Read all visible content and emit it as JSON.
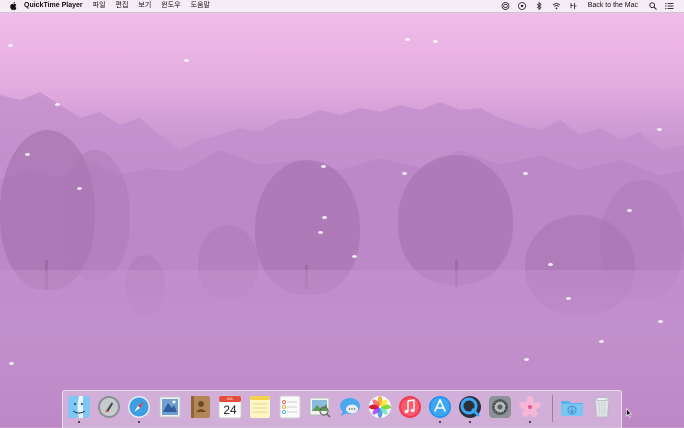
{
  "menubar": {
    "app_name": "QuickTime Player",
    "menus": [
      "파일",
      "편집",
      "보기",
      "윈도우",
      "도움말"
    ],
    "user_name": "Back to the Mac",
    "status_icons": [
      "quicktime-record-icon",
      "info-icon",
      "bluetooth-icon",
      "wifi-icon",
      "input-source-icon"
    ],
    "right_icons": [
      "spotlight-icon",
      "notification-center-icon"
    ]
  },
  "dock": {
    "items": [
      {
        "name": "finder",
        "icon": "finder-icon",
        "running": true
      },
      {
        "name": "launchpad",
        "icon": "launchpad-icon",
        "running": false
      },
      {
        "name": "safari",
        "icon": "safari-icon",
        "running": true
      },
      {
        "name": "mail",
        "icon": "mail-stamp-icon",
        "running": false
      },
      {
        "name": "contacts",
        "icon": "contacts-icon",
        "running": false
      },
      {
        "name": "calendar",
        "icon": "calendar-icon",
        "running": false,
        "month": "JUL",
        "day": "24"
      },
      {
        "name": "notes",
        "icon": "notes-icon",
        "running": false
      },
      {
        "name": "reminders",
        "icon": "reminders-icon",
        "running": false
      },
      {
        "name": "preview",
        "icon": "preview-icon",
        "running": false
      },
      {
        "name": "messages",
        "icon": "messages-icon",
        "running": false
      },
      {
        "name": "photos",
        "icon": "photos-icon",
        "running": false
      },
      {
        "name": "itunes",
        "icon": "itunes-icon",
        "running": false
      },
      {
        "name": "app-store",
        "icon": "app-store-icon",
        "running": true
      },
      {
        "name": "quicktime-player",
        "icon": "quicktime-icon",
        "running": true
      },
      {
        "name": "system-preferences",
        "icon": "system-preferences-icon",
        "running": false
      },
      {
        "name": "cherry-blossom",
        "icon": "cherry-blossom-icon",
        "running": true
      },
      {
        "name": "downloads",
        "icon": "downloads-folder-icon",
        "running": false
      },
      {
        "name": "trash",
        "icon": "trash-icon",
        "running": false
      }
    ]
  },
  "colors": {
    "sky_top": "#f2bfe9",
    "mist": "#c48fcc",
    "tree": "#a873b3",
    "menubar": "#f5f0f6"
  }
}
